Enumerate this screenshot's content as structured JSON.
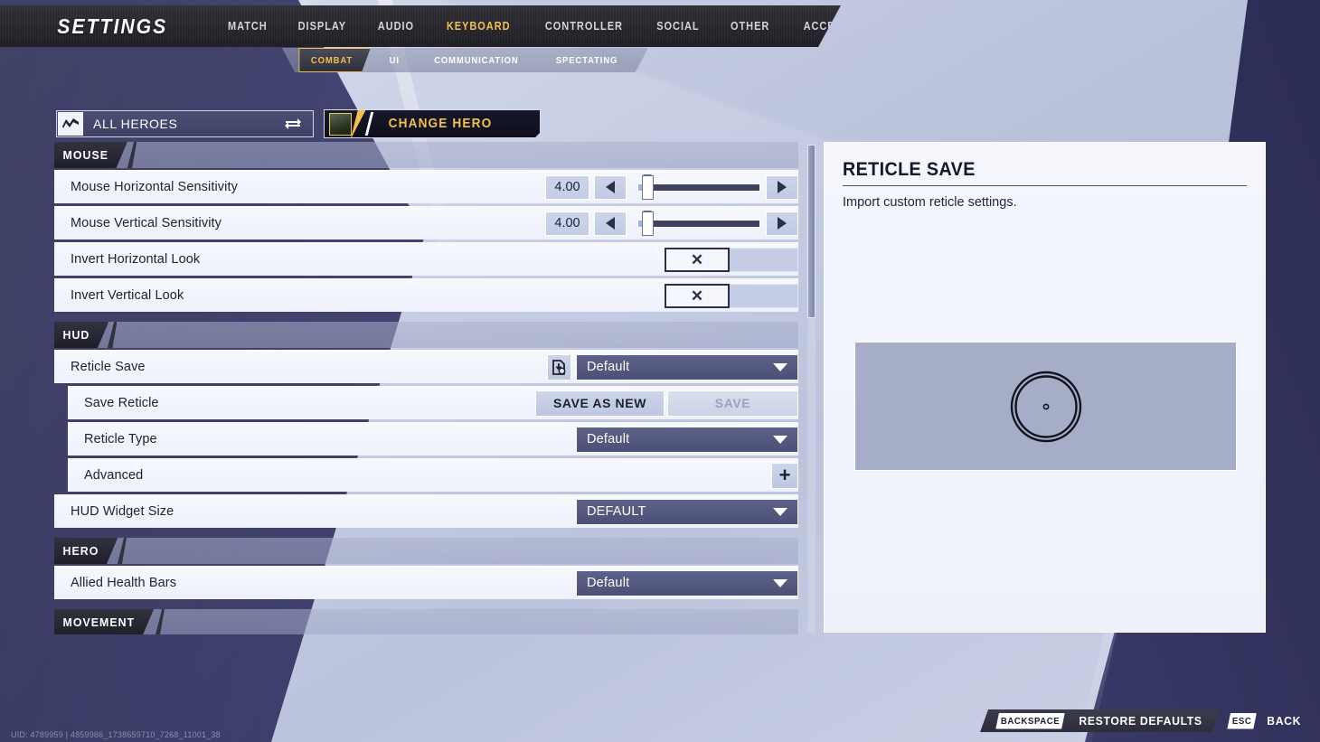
{
  "app": {
    "title": "SETTINGS"
  },
  "top_nav": {
    "items": [
      {
        "label": "MATCH",
        "active": false
      },
      {
        "label": "DISPLAY",
        "active": false
      },
      {
        "label": "AUDIO",
        "active": false
      },
      {
        "label": "KEYBOARD",
        "active": true
      },
      {
        "label": "CONTROLLER",
        "active": false
      },
      {
        "label": "SOCIAL",
        "active": false
      },
      {
        "label": "OTHER",
        "active": false
      },
      {
        "label": "ACCESSIBILITY",
        "active": false
      }
    ],
    "active_color": "#f2c14b"
  },
  "sub_nav": {
    "items": [
      {
        "label": "COMBAT",
        "active": true
      },
      {
        "label": "UI",
        "active": false
      },
      {
        "label": "COMMUNICATION",
        "active": false
      },
      {
        "label": "SPECTATING",
        "active": false
      }
    ]
  },
  "hero_bar": {
    "selector_label": "ALL HEROES",
    "selector_icon": "heroes-icon",
    "swap_icon": "swap-arrows-icon",
    "change_hero_label": "CHANGE HERO",
    "change_hero_portrait": "hero-portrait"
  },
  "sections": [
    {
      "name": "MOUSE",
      "rows": [
        {
          "type": "slider",
          "label": "Mouse Horizontal Sensitivity",
          "value": "4.00",
          "fill_percent": 4,
          "decrement_icon": "left-arrow-icon",
          "increment_icon": "right-arrow-icon"
        },
        {
          "type": "slider",
          "label": "Mouse Vertical Sensitivity",
          "value": "4.00",
          "fill_percent": 4,
          "decrement_icon": "left-arrow-icon",
          "increment_icon": "right-arrow-icon"
        },
        {
          "type": "toggle",
          "label": "Invert Horizontal Look",
          "checked_glyph": "✕",
          "checked": true
        },
        {
          "type": "toggle",
          "label": "Invert Vertical Look",
          "checked_glyph": "✕",
          "checked": true
        }
      ]
    },
    {
      "name": "HUD",
      "rows": [
        {
          "type": "dropdown_with_icon",
          "label": "Reticle Save",
          "value": "Default",
          "icon": "import-file-icon",
          "indent": false
        },
        {
          "type": "buttons",
          "label": "Save Reticle",
          "primary_label": "SAVE AS NEW",
          "secondary_label": "SAVE",
          "secondary_disabled": true,
          "indent": true
        },
        {
          "type": "dropdown",
          "label": "Reticle Type",
          "value": "Default",
          "indent": true
        },
        {
          "type": "expand",
          "label": "Advanced",
          "expand_glyph": "+",
          "indent": true
        },
        {
          "type": "dropdown",
          "label": "HUD Widget Size",
          "value": "DEFAULT",
          "indent": false
        }
      ]
    },
    {
      "name": "HERO",
      "rows": [
        {
          "type": "dropdown",
          "label": "Allied Health Bars",
          "value": "Default",
          "indent": false
        }
      ]
    },
    {
      "name": "MOVEMENT",
      "rows": []
    }
  ],
  "detail_panel": {
    "title": "RETICLE SAVE",
    "description": "Import custom reticle settings.",
    "preview_name": "reticle-preview"
  },
  "footer": {
    "hints": [
      {
        "key": "BACKSPACE",
        "label": "RESTORE DEFAULTS",
        "boxed": true
      },
      {
        "key": "ESC",
        "label": "BACK",
        "boxed": false
      }
    ]
  },
  "status": {
    "uid": "UID: 4789959 | 4859986_1738659710_7268_11001_38"
  }
}
